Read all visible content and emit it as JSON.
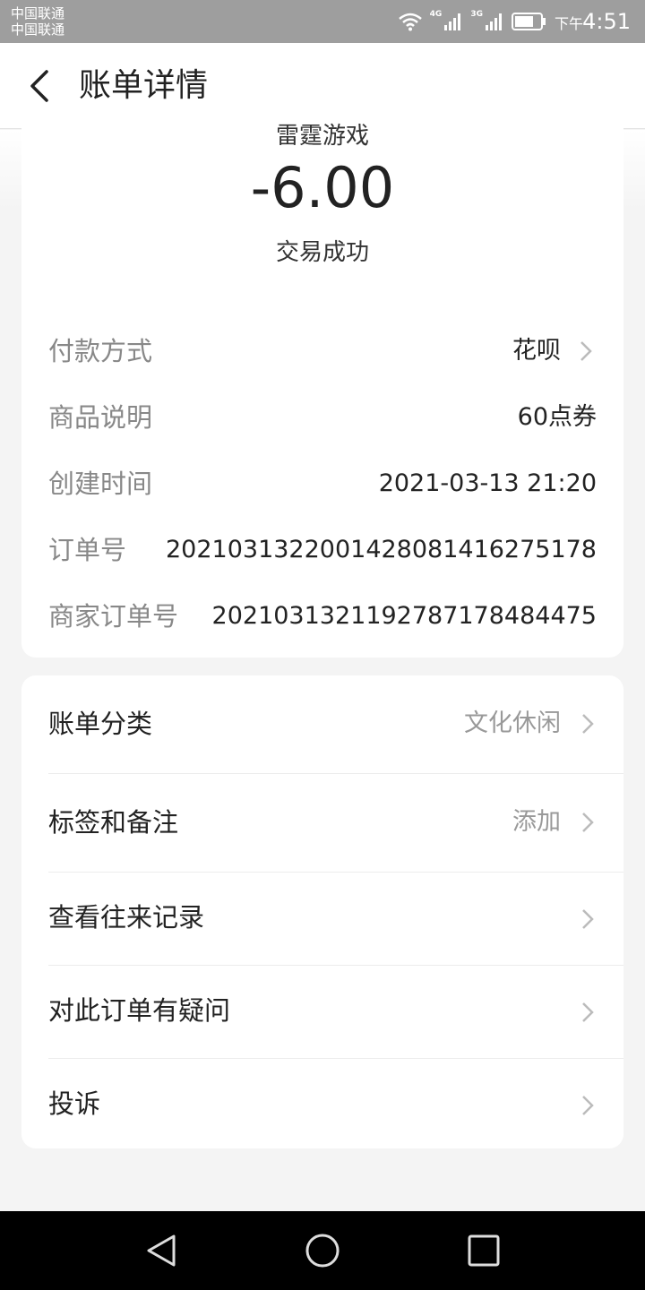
{
  "status_bar": {
    "carrier_line1": "中国联通",
    "carrier_line2": "中国联通",
    "net1": "4G",
    "net2": "3G",
    "time_prefix": "下午",
    "time": "4:51"
  },
  "header": {
    "title": "账单详情"
  },
  "summary": {
    "merchant": "雷霆游戏",
    "amount": "-6.00",
    "status": "交易成功"
  },
  "details": [
    {
      "label": "付款方式",
      "value": "花呗"
    },
    {
      "label": "商品说明",
      "value": "60点券"
    },
    {
      "label": "创建时间",
      "value": "2021-03-13 21:20"
    },
    {
      "label": "订单号",
      "value": "2021031322001428081416275178"
    },
    {
      "label": "商家订单号",
      "value": "2021031321192787178484475"
    }
  ],
  "menu": [
    {
      "label": "账单分类",
      "value": "文化休闲"
    },
    {
      "label": "标签和备注",
      "value": "添加"
    },
    {
      "label": "查看往来记录",
      "value": ""
    },
    {
      "label": "对此订单有疑问",
      "value": ""
    },
    {
      "label": "投诉",
      "value": ""
    }
  ],
  "colors": {
    "status_bar_bg": "#9e9e9e",
    "page_bg": "#f4f4f4",
    "card_bg": "#ffffff",
    "label_gray": "#888888",
    "nav_bar_bg": "#000000"
  }
}
